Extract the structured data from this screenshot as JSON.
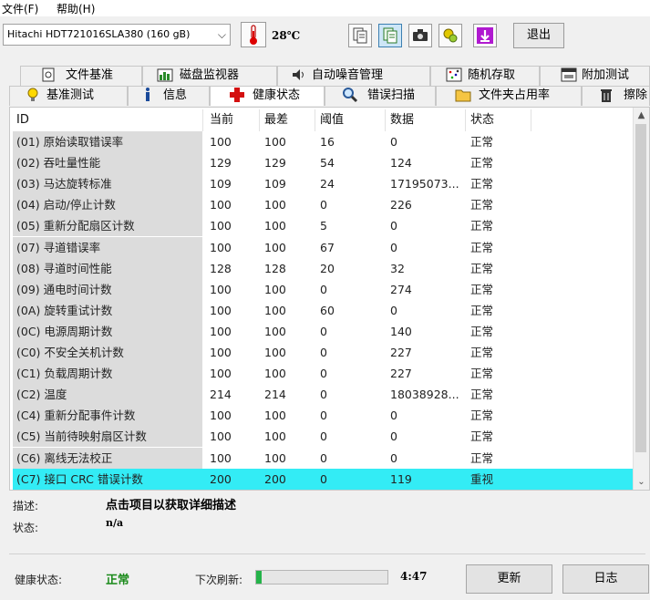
{
  "menu": {
    "file": "文件(F)",
    "help": "帮助(H)"
  },
  "toolbar": {
    "drive": "Hitachi HDT721016SLA380 (160 gB)",
    "temperature": "28℃",
    "exit_label": "退出"
  },
  "tabs_row1": [
    {
      "label": "文件基准",
      "icon": "document-gear-icon"
    },
    {
      "label": "磁盘监视器",
      "icon": "bar-chart-icon"
    },
    {
      "label": "自动噪音管理",
      "icon": "speaker-icon"
    },
    {
      "label": "随机存取",
      "icon": "random-dots-icon"
    },
    {
      "label": "附加测试",
      "icon": "window-icon"
    }
  ],
  "tabs_row2": [
    {
      "label": "基准测试",
      "icon": "lightbulb-icon"
    },
    {
      "label": "信息",
      "icon": "info-icon"
    },
    {
      "label": "健康状态",
      "icon": "red-cross-icon",
      "active": true
    },
    {
      "label": "错误扫描",
      "icon": "magnifier-icon"
    },
    {
      "label": "文件夹占用率",
      "icon": "folder-icon"
    },
    {
      "label": "擦除",
      "icon": "trash-icon"
    }
  ],
  "table": {
    "columns": [
      "ID",
      "当前",
      "最差",
      "阈值",
      "数据",
      "状态"
    ],
    "rows": [
      [
        "(01) 原始读取错误率",
        "100",
        "100",
        "16",
        "0",
        "正常"
      ],
      [
        "(02) 吞吐量性能",
        "129",
        "129",
        "54",
        "124",
        "正常"
      ],
      [
        "(03) 马达旋转标准",
        "109",
        "109",
        "24",
        "17195073...",
        "正常"
      ],
      [
        "(04) 启动/停止计数",
        "100",
        "100",
        "0",
        "226",
        "正常"
      ],
      [
        "(05) 重新分配扇区计数",
        "100",
        "100",
        "5",
        "0",
        "正常"
      ],
      [
        "(07) 寻道错误率",
        "100",
        "100",
        "67",
        "0",
        "正常"
      ],
      [
        "(08) 寻道时间性能",
        "128",
        "128",
        "20",
        "32",
        "正常"
      ],
      [
        "(09) 通电时间计数",
        "100",
        "100",
        "0",
        "274",
        "正常"
      ],
      [
        "(0A) 旋转重试计数",
        "100",
        "100",
        "60",
        "0",
        "正常"
      ],
      [
        "(0C) 电源周期计数",
        "100",
        "100",
        "0",
        "140",
        "正常"
      ],
      [
        "(C0) 不安全关机计数",
        "100",
        "100",
        "0",
        "227",
        "正常"
      ],
      [
        "(C1) 负载周期计数",
        "100",
        "100",
        "0",
        "227",
        "正常"
      ],
      [
        "(C2) 温度",
        "214",
        "214",
        "0",
        "18038928...",
        "正常"
      ],
      [
        "(C4) 重新分配事件计数",
        "100",
        "100",
        "0",
        "0",
        "正常"
      ],
      [
        "(C5) 当前待映射扇区计数",
        "100",
        "100",
        "0",
        "0",
        "正常"
      ],
      [
        "(C6) 离线无法校正",
        "100",
        "100",
        "0",
        "0",
        "正常"
      ],
      [
        "(C7) 接口 CRC 错误计数",
        "200",
        "200",
        "0",
        "119",
        "重视"
      ]
    ],
    "selected_row": 16,
    "selection_color": "#33ecf5"
  },
  "details": {
    "desc_label": "描述:",
    "desc_value": "点击项目以获取详细描述",
    "status_label": "状态:",
    "status_value": "n/a"
  },
  "footer": {
    "health_label": "健康状态:",
    "health_value": "正常",
    "next_refresh_label": "下次刷新:",
    "refresh_progress": 0.04,
    "countdown": "4:47",
    "refresh_button": "更新",
    "log_button": "日志"
  },
  "colors": {
    "health_ok": "#1a8a1a",
    "progress": "#25b34a"
  }
}
